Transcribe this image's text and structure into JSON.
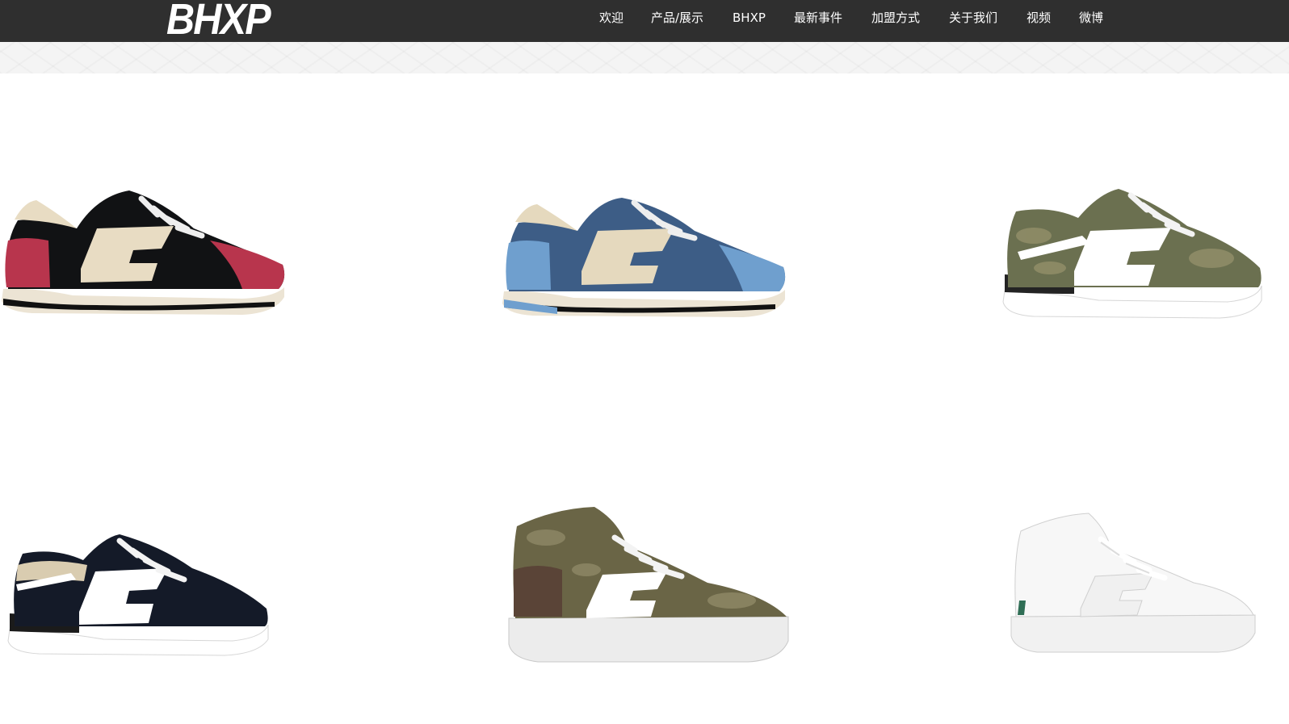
{
  "header": {
    "logo": "BHXP",
    "nav": [
      {
        "label": "欢迎"
      },
      {
        "label": "产品/展示"
      },
      {
        "label": "BHXP"
      },
      {
        "label": "最新事件"
      },
      {
        "label": "加盟方式"
      },
      {
        "label": "关于我们"
      },
      {
        "label": "视频"
      },
      {
        "label": "微博"
      }
    ]
  },
  "products": [
    {
      "name": "black-red-suede-runner",
      "upper": "#111214",
      "accent": "#b8354d",
      "panel": "#e8dcc3",
      "sole": "#ece4d4",
      "trim": "#111111",
      "lace": "#eeeeee"
    },
    {
      "name": "navy-blue-suede-runner",
      "upper": "#3d5d86",
      "accent": "#6f9fce",
      "panel": "#e5d9be",
      "sole": "#ece4d4",
      "trim": "#111111",
      "lace": "#eeeeee"
    },
    {
      "name": "green-camo-runner",
      "upper": "#6b7050",
      "accent": "#94906a",
      "panel": "#ffffff",
      "sole": "#ffffff",
      "trim": "#232323",
      "lace": "#f3f3f3"
    },
    {
      "name": "navy-runner",
      "upper": "#141a28",
      "accent": "#232a3a",
      "panel": "#ffffff",
      "sole": "#ffffff",
      "trim": "#1b1b1b",
      "lace": "#f3f3f3"
    },
    {
      "name": "camo-high-top",
      "upper": "#6a6546",
      "accent": "#5a4437",
      "panel": "#ffffff",
      "sole": "#ececec",
      "trim": "#c9c9c9",
      "lace": "#f3f3f3"
    },
    {
      "name": "white-high-top",
      "upper": "#f7f7f7",
      "accent": "#e4e4e4",
      "panel": "#f0f0f0",
      "sole": "#f1f1f1",
      "trim": "#cfcfcf",
      "lace": "#ffffff"
    }
  ]
}
